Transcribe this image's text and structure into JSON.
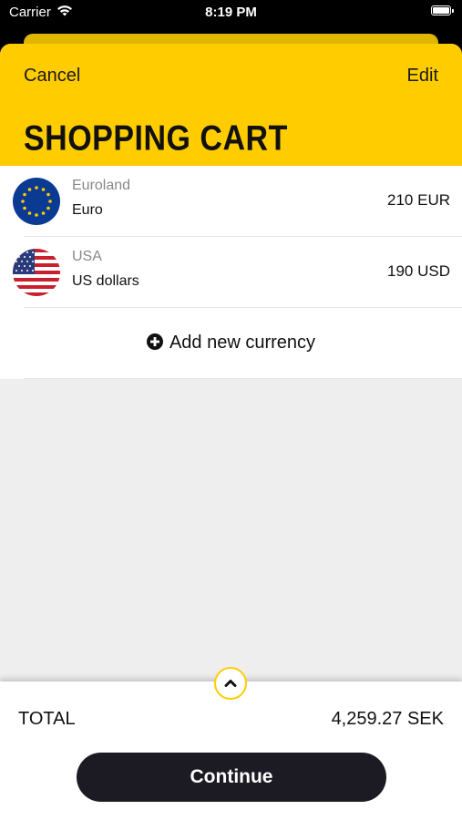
{
  "status_bar": {
    "carrier": "Carrier",
    "time": "8:19 PM",
    "wifi_icon": "wifi-icon",
    "battery_icon": "battery-icon"
  },
  "header": {
    "cancel_label": "Cancel",
    "edit_label": "Edit",
    "title": "SHOPPING CART"
  },
  "cart": {
    "items": [
      {
        "region": "Euroland",
        "currency": "Euro",
        "amount": "210 EUR",
        "flag_icon": "eu-flag-icon"
      },
      {
        "region": "USA",
        "currency": "US dollars",
        "amount": "190 USD",
        "flag_icon": "us-flag-icon"
      }
    ],
    "add_label": "Add new currency",
    "add_icon": "plus-circle-icon"
  },
  "footer": {
    "expand_icon": "chevron-up-icon",
    "total_label": "TOTAL",
    "total_value": "4,259.27 SEK",
    "continue_label": "Continue"
  },
  "colors": {
    "accent": "#ffcc00",
    "button_dark": "#1c1b24",
    "background": "#eeeeee"
  }
}
